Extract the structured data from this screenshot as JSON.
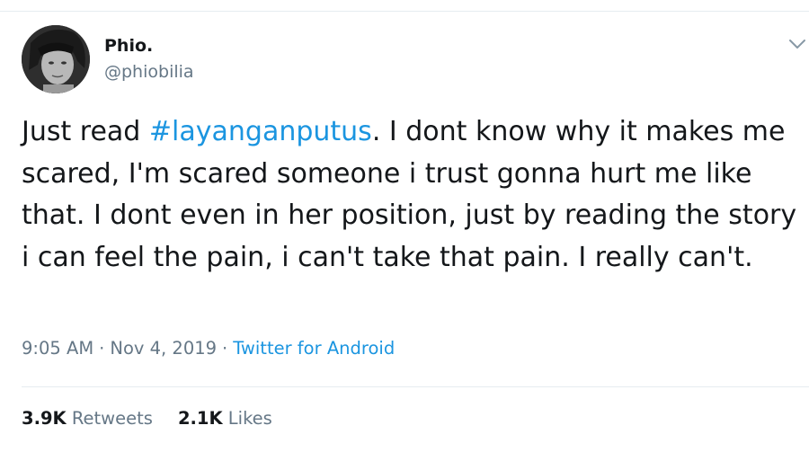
{
  "author": {
    "name": "Phio.",
    "handle": "@phiobilia"
  },
  "tweet": {
    "text_before": "Just read ",
    "hashtag": "#layanganputus",
    "text_after": ". I dont know why it makes me scared, I'm scared someone i trust gonna hurt me like that. I dont even in her position, just by reading the story i can feel the pain, i can't take that pain. I really can't."
  },
  "meta": {
    "time": "9:05 AM",
    "separator": "·",
    "date": "Nov 4, 2019",
    "source": "Twitter for Android"
  },
  "stats": {
    "retweets_count": "3.9K",
    "retweets_label": "Retweets",
    "likes_count": "2.1K",
    "likes_label": "Likes"
  },
  "icons": {
    "menu": "chevron-down-icon"
  },
  "colors": {
    "link": "#1b95e0",
    "secondary_text": "#657786",
    "divider": "#e6ecf0"
  }
}
